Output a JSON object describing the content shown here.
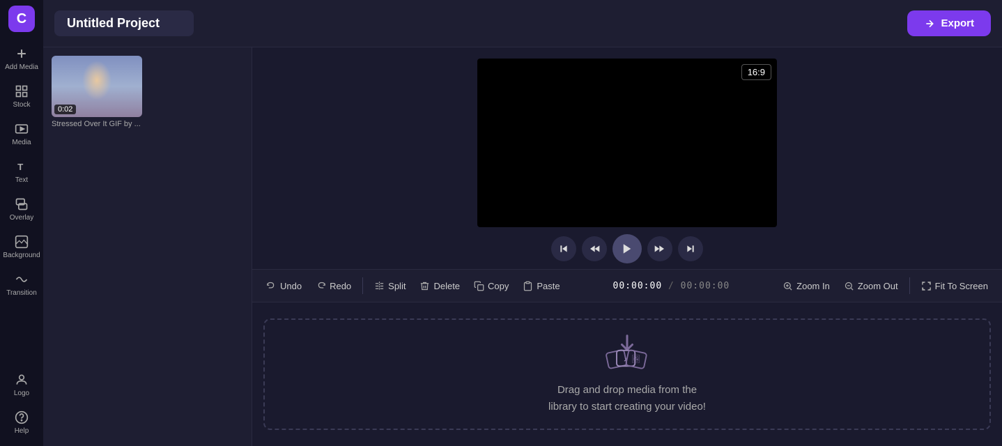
{
  "app": {
    "logo_letter": "C",
    "title": "Untitled Project",
    "aspect_ratio": "16:9",
    "export_label": "Export"
  },
  "sidebar": {
    "items": [
      {
        "id": "add-media",
        "label": "Add Media",
        "icon": "plus"
      },
      {
        "id": "stock",
        "label": "Stock",
        "icon": "stock"
      },
      {
        "id": "media",
        "label": "Media",
        "icon": "media"
      },
      {
        "id": "text",
        "label": "Text",
        "icon": "text"
      },
      {
        "id": "overlay",
        "label": "Overlay",
        "icon": "overlay"
      },
      {
        "id": "background",
        "label": "Background",
        "icon": "background"
      },
      {
        "id": "transition",
        "label": "Transition",
        "icon": "transition"
      },
      {
        "id": "logo",
        "label": "Logo",
        "icon": "logo"
      },
      {
        "id": "help",
        "label": "Help",
        "icon": "help"
      }
    ]
  },
  "media_panel": {
    "items": [
      {
        "id": "media-1",
        "duration": "0:02",
        "title": "Stressed Over It GIF by ..."
      }
    ]
  },
  "toolbar": {
    "undo_label": "Undo",
    "redo_label": "Redo",
    "split_label": "Split",
    "delete_label": "Delete",
    "copy_label": "Copy",
    "paste_label": "Paste",
    "zoom_in_label": "Zoom In",
    "zoom_out_label": "Zoom Out",
    "fit_to_screen_label": "Fit To Screen",
    "timecode_current": "00:00:00",
    "timecode_total": "00:00:00"
  },
  "timeline": {
    "drop_line1": "Drag and drop media from the",
    "drop_line2": "library to start creating your video!"
  }
}
